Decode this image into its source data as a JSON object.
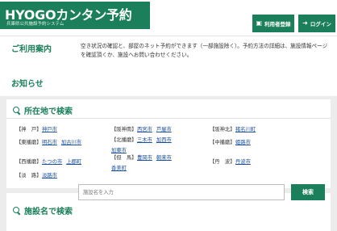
{
  "header": {
    "logo_title": "HYOGOカンタン予約",
    "logo_subtitle": "兵庫県公共施設予約システム",
    "register_label": "利用者登録",
    "login_label": "ログイン"
  },
  "guide": {
    "title": "ご利用案内",
    "text": "空き状況の確認と、部屋のネット予約ができます（一部施設除く）。予約方法の詳細は、施設情報ページを確認頂くか、施設へお問い合わせください。"
  },
  "news": {
    "title": "お知らせ"
  },
  "location_search": {
    "title": "所在地で検索",
    "regions": [
      {
        "label": "【神　戸】",
        "cities": [
          "神戸市"
        ]
      },
      {
        "label": "【阪神南】",
        "cities": [
          "西宮市",
          "芦屋市"
        ]
      },
      {
        "label": "【阪神北】",
        "cities": [
          "猪名川町"
        ]
      },
      {
        "label": "【東播磨】",
        "cities": [
          "明石市",
          "加古川市"
        ]
      },
      {
        "label": "【北播磨】",
        "cities": [
          "三木市",
          "加西市",
          "加東市"
        ]
      },
      {
        "label": "【中播磨】",
        "cities": [
          "姫路市"
        ]
      },
      {
        "label": "【西播磨】",
        "cities": [
          "たつの市",
          "上郡町"
        ]
      },
      {
        "label": "【但　馬】",
        "cities": [
          "豊岡市",
          "朝来市",
          "香美町"
        ]
      },
      {
        "label": "【丹　波】",
        "cities": [
          "丹波市"
        ]
      },
      {
        "label": "【淡　路】",
        "cities": [
          "淡路市"
        ]
      }
    ]
  },
  "name_search": {
    "title": "施設名で検索",
    "placeholder": "施設名を入力",
    "button_label": "検索"
  }
}
